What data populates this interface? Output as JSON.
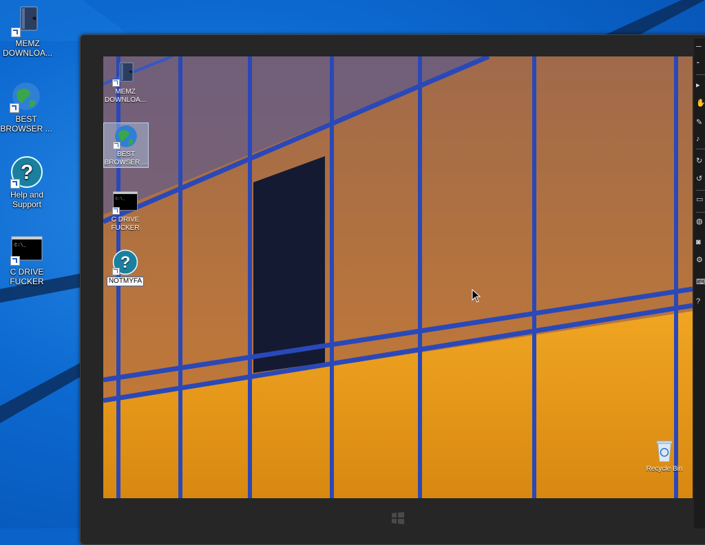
{
  "desktop": {
    "icons": [
      {
        "label": "MEMZ DOWNLOA...",
        "icon": "book-shortcut-icon"
      },
      {
        "label": "BEST BROWSER ...",
        "icon": "globe-icon"
      },
      {
        "label": "Help and Support",
        "icon": "help-icon"
      },
      {
        "label": "C DRIVE FUCKER",
        "icon": "console-icon"
      }
    ]
  },
  "tablet": {
    "icons": [
      {
        "label": "MEMZ DOWNLOA...",
        "icon": "book-shortcut-icon"
      },
      {
        "label": "BEST BROWSER ...",
        "icon": "globe-icon"
      },
      {
        "label": "C DRIVE FUCKER",
        "icon": "console-icon"
      },
      {
        "label": "NOTMYFA",
        "icon": "help-icon",
        "renaming": true
      }
    ],
    "recycle_bin": {
      "label": "Recycle Bin",
      "icon": "recycle-bin-icon"
    },
    "windows_button": "windows-logo-icon",
    "toolbar_icons": [
      "minimize-icon",
      "pin-icon",
      "pointer-icon",
      "hand-icon",
      "pen-icon",
      "volume-icon",
      "rotate-icon",
      "rotate-alt-icon",
      "display-icon",
      "globe-icon",
      "camera-icon",
      "settings-icon",
      "keyboard-icon",
      "more-icon"
    ]
  },
  "colors": {
    "accent": "#0a63c9",
    "building_orange": "#e08d14",
    "frame": "#262626"
  }
}
